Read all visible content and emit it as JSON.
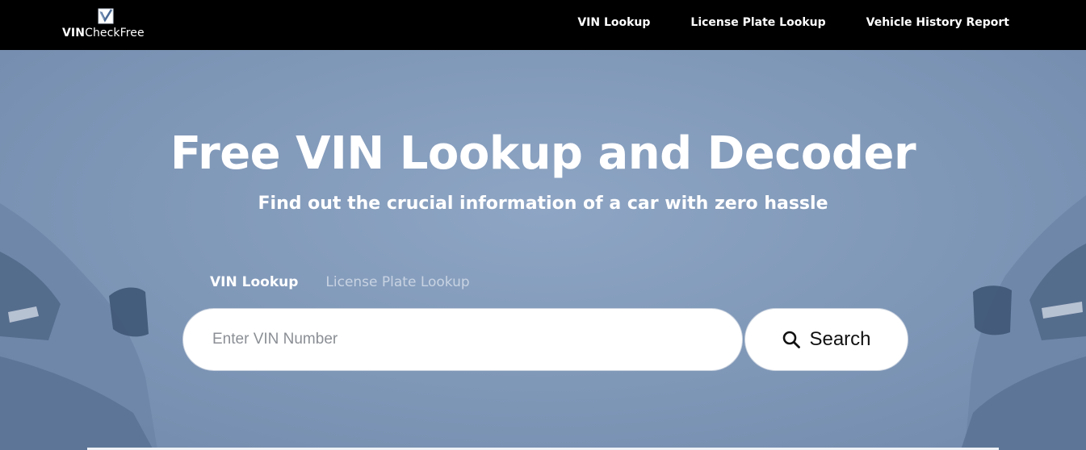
{
  "brand": {
    "name_bold": "VIN",
    "name_regular": "CheckFree",
    "icon": "checkmark-logo-icon"
  },
  "nav": {
    "items": [
      {
        "label": "VIN Lookup"
      },
      {
        "label": "License Plate Lookup"
      },
      {
        "label": "Vehicle History Report"
      }
    ]
  },
  "hero": {
    "title": "Free VIN Lookup and Decoder",
    "subtitle": "Find out the crucial information of a car with zero hassle"
  },
  "search": {
    "tabs": [
      {
        "label": "VIN Lookup",
        "active": true
      },
      {
        "label": "License Plate Lookup",
        "active": false
      }
    ],
    "placeholder": "Enter VIN Number",
    "value": "",
    "button_label": "Search",
    "button_icon": "search-icon"
  },
  "colors": {
    "topbar": "#000000",
    "hero_background": "#7f97b7",
    "text_light": "#ffffff",
    "tab_inactive": "#c8d3e2"
  }
}
